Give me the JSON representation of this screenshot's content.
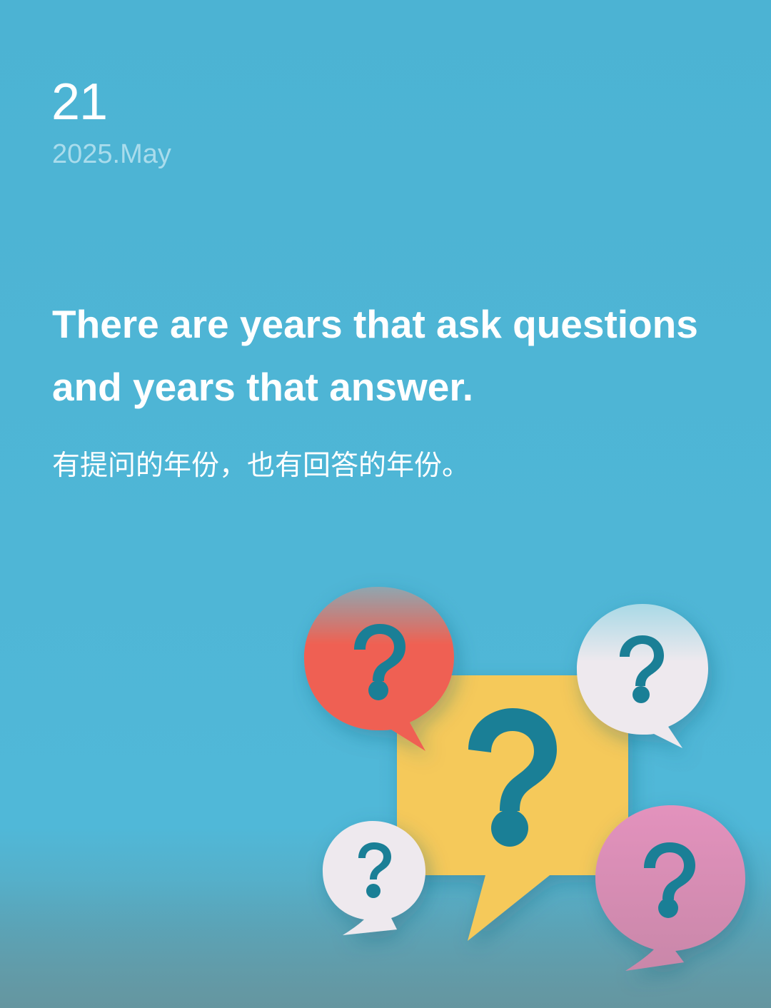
{
  "date": {
    "day": "21",
    "month": "2025.May"
  },
  "quote": {
    "en": "There are years that ask questions and years that answer.",
    "zh": "有提问的年份，也有回答的年份。"
  },
  "illustration": {
    "colors": {
      "background": "#4fb6d6",
      "yellow": "#f5c95a",
      "red": "#ef6152",
      "pink": "#e08fb9",
      "white": "#efe9ee",
      "mark": "#1a7f96"
    }
  }
}
